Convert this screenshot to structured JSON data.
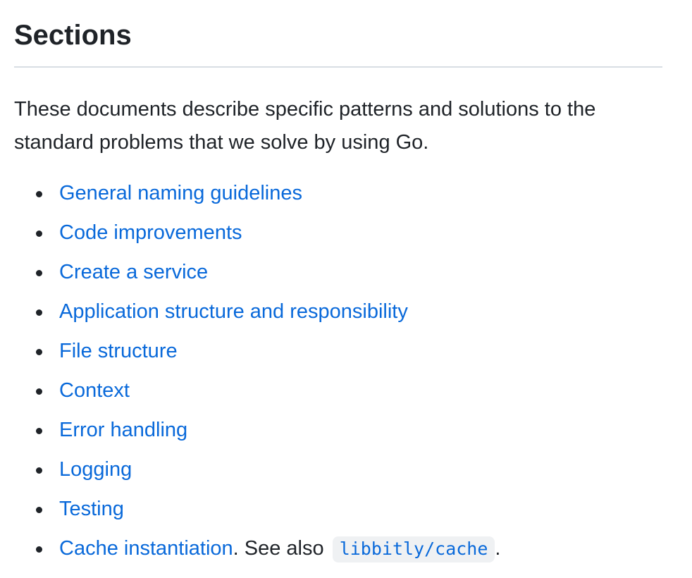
{
  "heading": "Sections",
  "intro": "These documents describe specific patterns and solutions to the standard problems that we solve by using Go.",
  "items": [
    {
      "label": "General naming guidelines"
    },
    {
      "label": "Code improvements"
    },
    {
      "label": "Create a service"
    },
    {
      "label": "Application structure and responsibility"
    },
    {
      "label": "File structure"
    },
    {
      "label": "Context"
    },
    {
      "label": "Error handling"
    },
    {
      "label": "Logging"
    },
    {
      "label": "Testing"
    },
    {
      "label": "Cache instantiation",
      "suffix": ". See also ",
      "code": "libbitly/cache",
      "end": "."
    }
  ],
  "colors": {
    "link": "#0969da",
    "text": "#1f2328",
    "rule": "#d8dee4",
    "code_bg": "#eff1f3"
  }
}
